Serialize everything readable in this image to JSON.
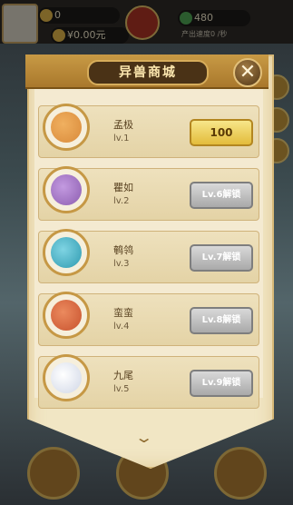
{
  "header": {
    "gold": "0",
    "cash": "¥0.00元",
    "green_value": "480",
    "badge_text": "",
    "sub_text": "产出速度0 /秒"
  },
  "shop": {
    "title": "异兽商城",
    "close_icon": "close-icon",
    "items": [
      {
        "name": "孟极",
        "level": "lv.1",
        "action": "100",
        "state": "buy",
        "color": "#d98a3a"
      },
      {
        "name": "瞿如",
        "level": "lv.2",
        "action": "Lv.6解锁",
        "state": "locked",
        "color": "#8c5db0"
      },
      {
        "name": "鹌鸰",
        "level": "lv.3",
        "action": "Lv.7解锁",
        "state": "locked",
        "color": "#2f9ab0"
      },
      {
        "name": "蛮蛮",
        "level": "lv.4",
        "action": "Lv.8解锁",
        "state": "locked",
        "color": "#c8522e"
      },
      {
        "name": "九尾",
        "level": "lv.5",
        "action": "Lv.9解锁",
        "state": "locked",
        "color": "#cfd6e6"
      }
    ]
  },
  "colors": {
    "accent": "#c69845",
    "buy_button": "#e3bc3b",
    "locked_button": "#a9a9a9"
  }
}
